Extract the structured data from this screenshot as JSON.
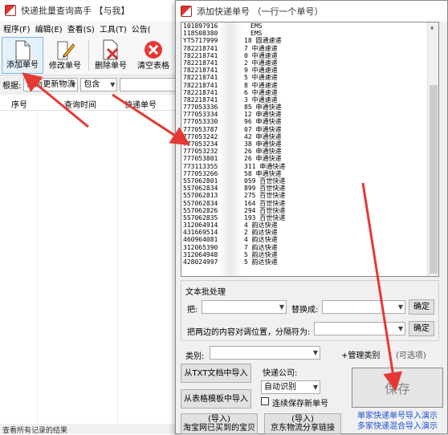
{
  "main": {
    "title": "快递批量查询高手 【与我】",
    "menu": [
      "程序(F)",
      "编辑(E)",
      "查看(S)",
      "工具(T)",
      "公告("
    ],
    "toolbar": {
      "add": "添加单号",
      "edit": "修改单号",
      "delete": "删除单号",
      "clear": "清空表格"
    },
    "filter": {
      "label": "根据:",
      "field": "最后更新物流",
      "op": "包含",
      "value": ""
    },
    "columns": [
      "序号",
      "查询时间",
      "快递单号"
    ],
    "status": "查看所有记录的结果"
  },
  "dialog": {
    "title": "添加快递单号 （一行一个单号）",
    "lines": [
      {
        "num": "1018979162",
        "suffix": "",
        "company": "EMS"
      },
      {
        "num": "1185083801",
        "suffix": "",
        "company": "EMS"
      },
      {
        "num": "YT5717999",
        "suffix": "18",
        "company": "圆通速递"
      },
      {
        "num": "782218741",
        "suffix": "7",
        "company": "中通速递"
      },
      {
        "num": "782218741",
        "suffix": "0",
        "company": "中通速递"
      },
      {
        "num": "782218741",
        "suffix": "2",
        "company": "中通速递"
      },
      {
        "num": "782218741",
        "suffix": "9",
        "company": "中通速递"
      },
      {
        "num": "782218741",
        "suffix": "5",
        "company": "中通速递"
      },
      {
        "num": "782218741",
        "suffix": "8",
        "company": "中通速递"
      },
      {
        "num": "782218741",
        "suffix": "6",
        "company": "中通速递"
      },
      {
        "num": "782218741",
        "suffix": "3",
        "company": "中通速递"
      },
      {
        "num": "7770533365",
        "suffix": "85",
        "company": "申通快递"
      },
      {
        "num": "7770533346",
        "suffix": "12",
        "company": "申通快递"
      },
      {
        "num": "7770533309",
        "suffix": "96",
        "company": "申通快递"
      },
      {
        "num": "7770537871",
        "suffix": "07",
        "company": "申通快递"
      },
      {
        "num": "7770532425",
        "suffix": "42",
        "company": "申通快递"
      },
      {
        "num": "7770532347",
        "suffix": "38",
        "company": "申通快递"
      },
      {
        "num": "7770532327",
        "suffix": "26",
        "company": "申通快递"
      },
      {
        "num": "7770538013",
        "suffix": "26",
        "company": "申通快递"
      },
      {
        "num": "7731133552",
        "suffix": "311",
        "company": "申通快递"
      },
      {
        "num": "7770532660",
        "suffix": "58",
        "company": "申通快递"
      },
      {
        "num": "5570628016",
        "suffix": "059",
        "company": "百世快递"
      },
      {
        "num": "5570628344",
        "suffix": "899",
        "company": "百世快递"
      },
      {
        "num": "5570628131",
        "suffix": "275",
        "company": "百世快递"
      },
      {
        "num": "5570628340",
        "suffix": "164",
        "company": "百世快递"
      },
      {
        "num": "5570628267",
        "suffix": "294",
        "company": "百世快递"
      },
      {
        "num": "5570628355",
        "suffix": "193",
        "company": "百世快递"
      },
      {
        "num": "3120649140",
        "suffix": "4",
        "company": "韵达快递"
      },
      {
        "num": "4316695140",
        "suffix": "2",
        "company": "韵达快递"
      },
      {
        "num": "4609640811",
        "suffix": "4",
        "company": "韵达快递"
      },
      {
        "num": "3120653900",
        "suffix": "7",
        "company": "韵达快递"
      },
      {
        "num": "3120649481",
        "suffix": "5",
        "company": "韵达快递"
      },
      {
        "num": "4280249970",
        "suffix": "5",
        "company": "韵达快递"
      }
    ],
    "batch": {
      "title": "文本批处理",
      "replace_label": "把:",
      "replace_with_label": "替换成:",
      "ok1": "确定",
      "align_label": "把两边的内容对调位置，分隔符为:",
      "ok2": "确定"
    },
    "category_label": "类别:",
    "manage_category": "+管理类别",
    "optional": "(可选项)",
    "import_txt": "从TXT文档中导入",
    "import_template": "从表格模板中导入",
    "courier_label": "快递公司:",
    "courier_value": "自动识别",
    "continuous_label": "连续保存新单号",
    "save": "保存",
    "import_taobao_top": "(导入)",
    "import_taobao": "淘宝网已买到的宝贝",
    "import_jd_top": "(导入)",
    "import_jd": "京东物流分享链接",
    "link1": "单家快递单号导入演示",
    "link2": "多家快递混合导入演示"
  },
  "colors": {
    "arrow": "#e53935",
    "link": "#1a4fd6",
    "accent": "#7fb3e6"
  }
}
